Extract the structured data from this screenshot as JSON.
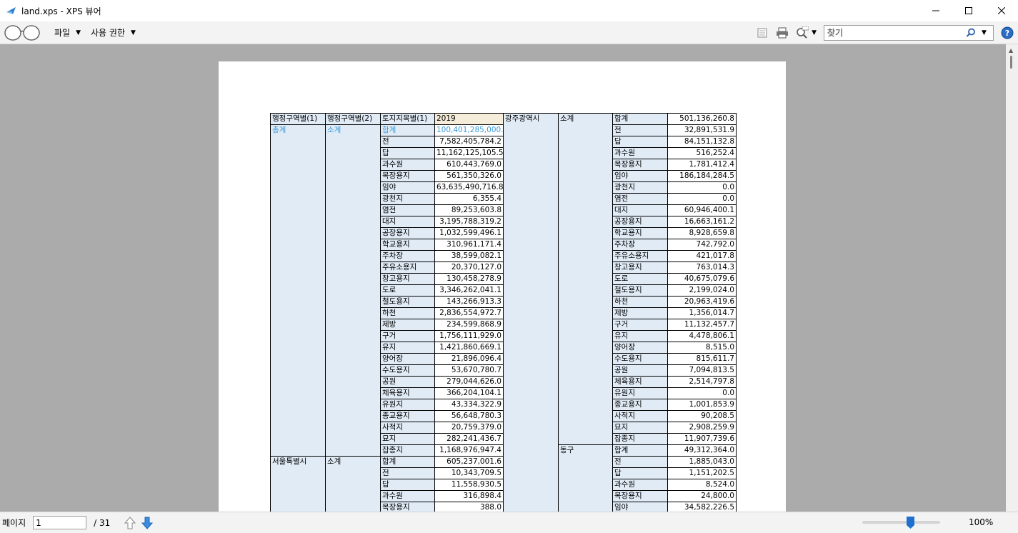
{
  "window": {
    "title": "land.xps - XPS 뷰어"
  },
  "toolbar": {
    "menu_file": "파일",
    "menu_permissions": "사용 권한",
    "search_placeholder": "찾기"
  },
  "status": {
    "page_label": "페이지",
    "page_current": "1",
    "page_total": "/ 31",
    "zoom": "100%",
    "zoom_level_percent": 100
  },
  "table": {
    "headers": [
      "행정구역별(1)",
      "행정구역별(2)",
      "토지지목별(1)",
      "2019"
    ],
    "left_groups": [
      {
        "region1": "총계",
        "region2": "소계",
        "rows": [
          [
            "합계",
            "100,401,285,000.0"
          ],
          [
            "전",
            "7,582,405,784.2"
          ],
          [
            "답",
            "11,162,125,105.5"
          ],
          [
            "과수원",
            "610,443,769.0"
          ],
          [
            "목장용지",
            "561,350,326.0"
          ],
          [
            "임야",
            "63,635,490,716.8"
          ],
          [
            "광천지",
            "6,355.4"
          ],
          [
            "염전",
            "89,253,603.8"
          ],
          [
            "대지",
            "3,195,788,319.2"
          ],
          [
            "공장용지",
            "1,032,599,496.1"
          ],
          [
            "학교용지",
            "310,961,171.4"
          ],
          [
            "주차장",
            "38,599,082.1"
          ],
          [
            "주유소용지",
            "20,370,127.0"
          ],
          [
            "창고용지",
            "130,458,278.9"
          ],
          [
            "도로",
            "3,346,262,041.1"
          ],
          [
            "철도용지",
            "143,266,913.3"
          ],
          [
            "하천",
            "2,836,554,972.7"
          ],
          [
            "제방",
            "234,599,868.9"
          ],
          [
            "구거",
            "1,756,111,929.0"
          ],
          [
            "유지",
            "1,421,860,669.1"
          ],
          [
            "양어장",
            "21,896,096.4"
          ],
          [
            "수도용지",
            "53,670,780.7"
          ],
          [
            "공원",
            "279,044,626.0"
          ],
          [
            "체육용지",
            "366,204,104.1"
          ],
          [
            "유원지",
            "43,334,322.9"
          ],
          [
            "종교용지",
            "56,648,780.3"
          ],
          [
            "사적지",
            "20,759,379.0"
          ],
          [
            "묘지",
            "282,241,436.7"
          ],
          [
            "잡종지",
            "1,168,976,947.4"
          ]
        ]
      },
      {
        "region1": "서울특별시",
        "region2": "소계",
        "rows": [
          [
            "합계",
            "605,237,001.6"
          ],
          [
            "전",
            "10,343,709.5"
          ],
          [
            "답",
            "11,558,930.5"
          ],
          [
            "과수원",
            "316,898.4"
          ],
          [
            "목장용지",
            "388.0"
          ]
        ]
      }
    ],
    "right_region1": "광주광역시",
    "right_groups": [
      {
        "region2": "소계",
        "rows": [
          [
            "합계",
            "501,136,260.8"
          ],
          [
            "전",
            "32,891,531.9"
          ],
          [
            "답",
            "84,151,132.8"
          ],
          [
            "과수원",
            "516,252.4"
          ],
          [
            "목장용지",
            "1,781,412.4"
          ],
          [
            "임야",
            "186,184,284.5"
          ],
          [
            "광천지",
            "0.0"
          ],
          [
            "염전",
            "0.0"
          ],
          [
            "대지",
            "60,946,400.1"
          ],
          [
            "공장용지",
            "16,663,161.2"
          ],
          [
            "학교용지",
            "8,928,659.8"
          ],
          [
            "주차장",
            "742,792.0"
          ],
          [
            "주유소용지",
            "421,017.8"
          ],
          [
            "창고용지",
            "763,014.3"
          ],
          [
            "도로",
            "40,675,079.6"
          ],
          [
            "철도용지",
            "2,199,024.0"
          ],
          [
            "하천",
            "20,963,419.6"
          ],
          [
            "제방",
            "1,356,014.7"
          ],
          [
            "구거",
            "11,132,457.7"
          ],
          [
            "유지",
            "4,478,806.1"
          ],
          [
            "양어장",
            "8,515.0"
          ],
          [
            "수도용지",
            "815,611.7"
          ],
          [
            "공원",
            "7,094,813.5"
          ],
          [
            "체육용지",
            "2,514,797.8"
          ],
          [
            "유원지",
            "0.0"
          ],
          [
            "종교용지",
            "1,001,853.9"
          ],
          [
            "사적지",
            "90,208.5"
          ],
          [
            "묘지",
            "2,908,259.9"
          ],
          [
            "잡종지",
            "11,907,739.6"
          ]
        ]
      },
      {
        "region2": "동구",
        "rows": [
          [
            "합계",
            "49,312,364.0"
          ],
          [
            "전",
            "1,885,043.0"
          ],
          [
            "답",
            "1,151,202.5"
          ],
          [
            "과수원",
            "8,524.0"
          ],
          [
            "목장용지",
            "24,800.0"
          ],
          [
            "임야",
            "34,582,226.5"
          ]
        ]
      }
    ]
  }
}
